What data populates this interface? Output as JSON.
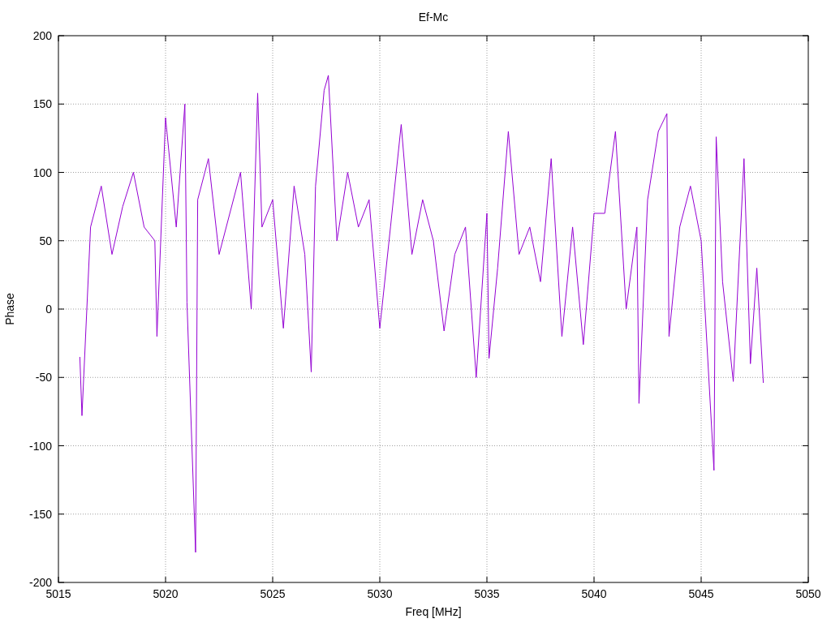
{
  "chart": {
    "chart_data": {
      "type": "line",
      "title": "Ef-Mc",
      "xlabel": "Freq [MHz]",
      "ylabel": "Phase",
      "xlim": [
        5015,
        5050
      ],
      "ylim": [
        -200,
        200
      ],
      "grid": true,
      "xticks": [
        5015,
        5020,
        5025,
        5030,
        5035,
        5040,
        5045,
        5050
      ],
      "yticks": [
        -200,
        -150,
        -100,
        -50,
        0,
        50,
        100,
        150,
        200
      ],
      "x": [
        5016.0,
        5016.1,
        5016.5,
        5017.0,
        5017.5,
        5018.0,
        5018.5,
        5019.0,
        5019.5,
        5019.6,
        5020.0,
        5020.5,
        5020.9,
        5021.0,
        5021.4,
        5021.5,
        5022.0,
        5022.5,
        5023.0,
        5023.5,
        5024.0,
        5024.3,
        5024.5,
        5025.0,
        5025.5,
        5026.0,
        5026.5,
        5026.8,
        5027.0,
        5027.4,
        5027.6,
        5028.0,
        5028.5,
        5029.0,
        5029.5,
        5030.0,
        5030.5,
        5031.0,
        5031.5,
        5032.0,
        5032.5,
        5033.0,
        5033.5,
        5034.0,
        5034.5,
        5035.0,
        5035.1,
        5035.5,
        5036.0,
        5036.5,
        5037.0,
        5037.5,
        5038.0,
        5038.5,
        5039.0,
        5039.5,
        5040.0,
        5040.5,
        5041.0,
        5041.5,
        5042.0,
        5042.1,
        5042.5,
        5043.0,
        5043.4,
        5043.5,
        5044.0,
        5044.5,
        5045.0,
        5045.6,
        5045.7,
        5046.0,
        5046.5,
        5047.0,
        5047.3,
        5047.6,
        5047.9
      ],
      "series": [
        {
          "color": "#9400d3",
          "values": [
            -35,
            -78,
            60,
            90,
            40,
            75,
            100,
            60,
            50,
            -20,
            140,
            60,
            150,
            5,
            -178,
            80,
            110,
            40,
            70,
            100,
            0,
            158,
            60,
            80,
            -14,
            90,
            40,
            -46,
            90,
            160,
            171,
            50,
            100,
            60,
            80,
            -14,
            60,
            135,
            40,
            80,
            50,
            -16,
            40,
            60,
            -50,
            70,
            -36,
            30,
            130,
            40,
            60,
            20,
            110,
            -20,
            60,
            -26,
            70,
            70,
            130,
            0,
            60,
            -69,
            80,
            130,
            143,
            -20,
            60,
            90,
            50,
            -118,
            126,
            20,
            -53,
            110,
            -40,
            30,
            -54
          ]
        }
      ]
    }
  }
}
